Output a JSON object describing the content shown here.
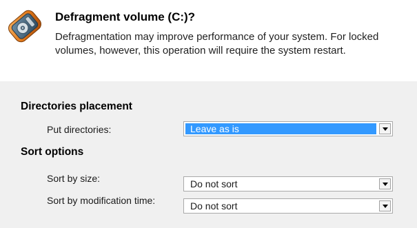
{
  "header": {
    "title": "Defragment volume (C:)?",
    "description": "Defragmentation may improve performance of your system. For locked volumes, however, this operation will require the system restart.",
    "icon": "disk-defragment-icon"
  },
  "directories_placement": {
    "heading": "Directories placement",
    "put_directories": {
      "label": "Put directories:",
      "value": "Leave as is"
    }
  },
  "sort_options": {
    "heading": "Sort options",
    "sort_by_size": {
      "label": "Sort by size:",
      "value": "Do not sort"
    },
    "sort_by_modification_time": {
      "label": "Sort by modification time:",
      "value": "Do not sort"
    }
  },
  "colors": {
    "selection": "#3399ff",
    "panel_background": "#f0f0f0",
    "header_background": "#ffffff",
    "icon_orange": "#e0781a"
  }
}
